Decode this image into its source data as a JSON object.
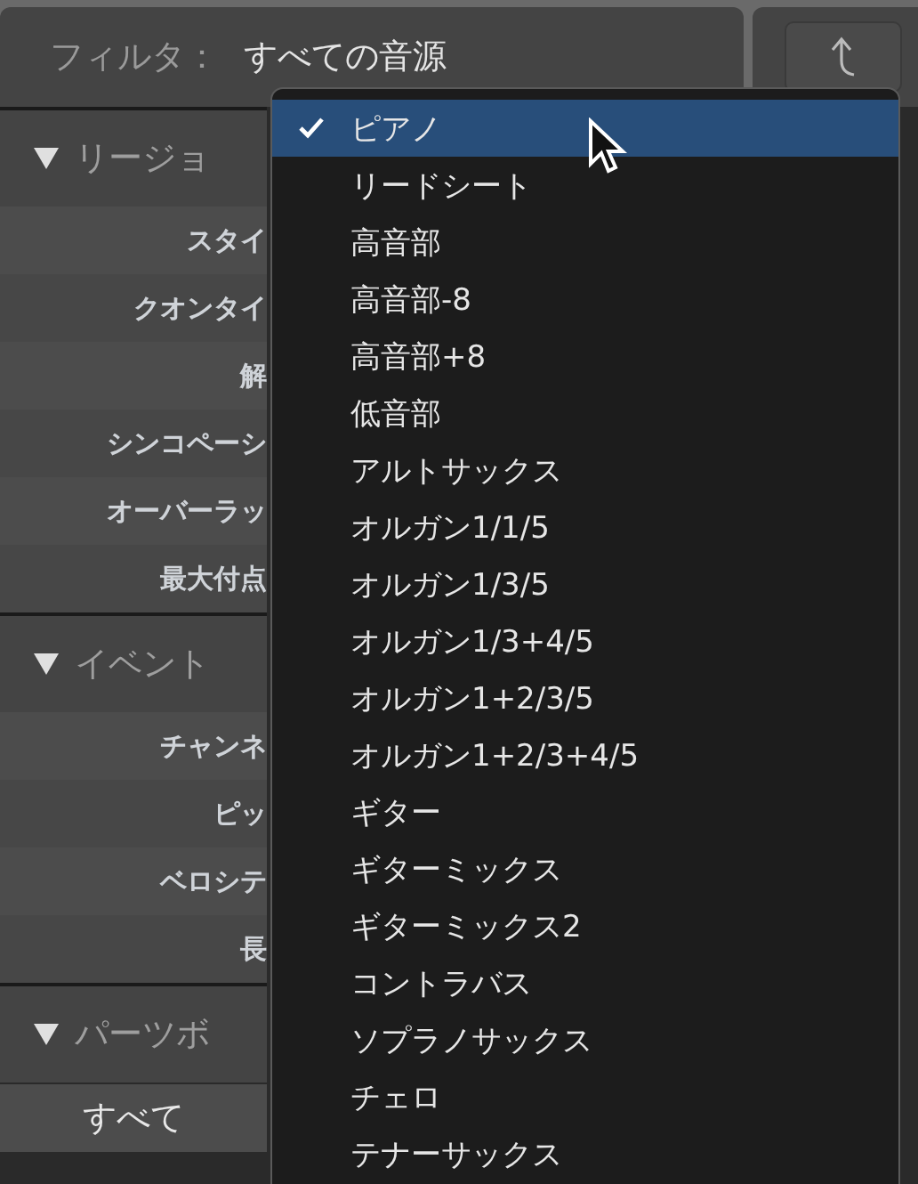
{
  "filter": {
    "label": "フィルタ：",
    "value": "すべての音源"
  },
  "sections": [
    {
      "title": "リージョ",
      "expanded": true,
      "kind": "params",
      "rows": [
        "スタイ",
        "クオンタイ",
        "解",
        "シンコペーシ",
        "オーバーラッ",
        "最大付点"
      ]
    },
    {
      "title": "イベント",
      "expanded": true,
      "kind": "params",
      "rows": [
        "チャンネ",
        "ピッ",
        "ベロシテ",
        "長"
      ]
    },
    {
      "title": "パーツボ",
      "expanded": true,
      "kind": "choice",
      "rows": [
        "すべて"
      ]
    }
  ],
  "menu": [
    {
      "label": "ピアノ",
      "selected": true
    },
    {
      "label": "リードシート",
      "selected": false
    },
    {
      "label": "高音部",
      "selected": false
    },
    {
      "label": "高音部-8",
      "selected": false
    },
    {
      "label": "高音部+8",
      "selected": false
    },
    {
      "label": "低音部",
      "selected": false
    },
    {
      "label": "アルトサックス",
      "selected": false
    },
    {
      "label": "オルガン1/1/5",
      "selected": false
    },
    {
      "label": "オルガン1/3/5",
      "selected": false
    },
    {
      "label": "オルガン1/3+4/5",
      "selected": false
    },
    {
      "label": "オルガン1+2/3/5",
      "selected": false
    },
    {
      "label": "オルガン1+2/3+4/5",
      "selected": false
    },
    {
      "label": "ギター",
      "selected": false
    },
    {
      "label": "ギターミックス",
      "selected": false
    },
    {
      "label": "ギターミックス2",
      "selected": false
    },
    {
      "label": "コントラバス",
      "selected": false
    },
    {
      "label": "ソプラノサックス",
      "selected": false
    },
    {
      "label": "チェロ",
      "selected": false
    },
    {
      "label": "テナーサックス",
      "selected": false
    }
  ]
}
